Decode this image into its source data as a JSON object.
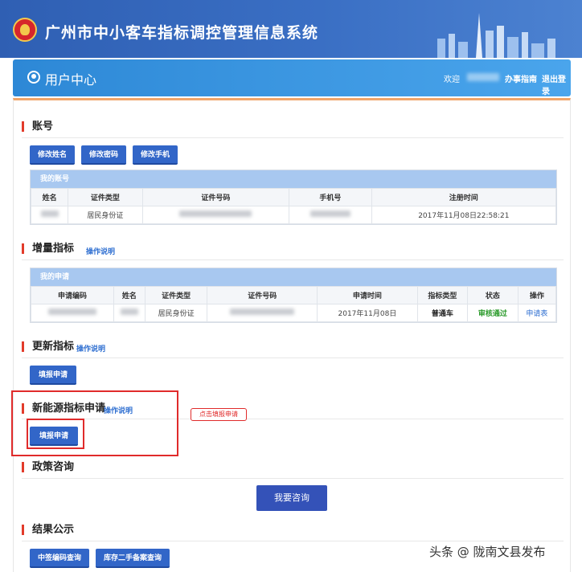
{
  "header": {
    "system_title": "广州市中小客车指标调控管理信息系统",
    "logo_icon": "guangzhou-emblem-icon"
  },
  "user_bar": {
    "title": "用户中心",
    "welcome": "欢迎",
    "guide_link": "办事指南",
    "logout_link": "退出登录"
  },
  "account": {
    "title": "账号",
    "buttons": [
      "修改姓名",
      "修改密码",
      "修改手机"
    ],
    "grid_title": "我的账号",
    "columns": [
      "姓名",
      "证件类型",
      "证件号码",
      "手机号",
      "注册时间"
    ],
    "row": {
      "id_type": "居民身份证",
      "reg_time": "2017年11月08日22:58:21"
    }
  },
  "quota": {
    "title": "增量指标",
    "help": "操作说明",
    "grid_title": "我的申请",
    "columns": [
      "申请编码",
      "姓名",
      "证件类型",
      "证件号码",
      "申请时间",
      "指标类型",
      "状态",
      "操作"
    ],
    "row": {
      "id_type": "居民身份证",
      "apply_time": "2017年11月08日",
      "quota_type": "普通车",
      "status": "审核通过",
      "action": "申请表"
    }
  },
  "renew": {
    "title": "更新指标",
    "help": "操作说明",
    "button": "填报申请"
  },
  "new_energy": {
    "title": "新能源指标申请",
    "help": "操作说明",
    "button": "填报申请",
    "callout": "点击填报申请"
  },
  "policy": {
    "title": "政策咨询",
    "button": "我要咨询"
  },
  "results": {
    "title": "结果公示",
    "buttons": [
      "中签编码查询",
      "库存二手备案查询"
    ]
  },
  "watermark": "头条 @ 陇南文县发布",
  "colors": {
    "primary": "#3266c8",
    "header": "#2f5fb3",
    "accent_red": "#e02b2b",
    "status_green": "#2a9a2a"
  }
}
